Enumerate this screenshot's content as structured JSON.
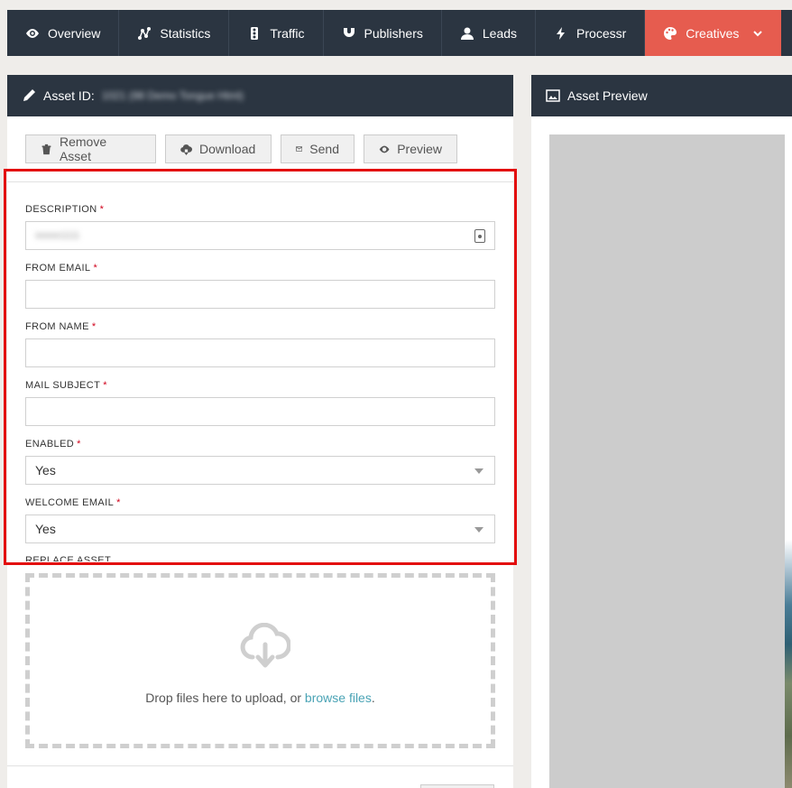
{
  "nav": {
    "items": [
      {
        "label": "Overview",
        "icon": "eye-icon"
      },
      {
        "label": "Statistics",
        "icon": "chart-line-icon"
      },
      {
        "label": "Traffic",
        "icon": "traffic-light-icon"
      },
      {
        "label": "Publishers",
        "icon": "magnet-icon"
      },
      {
        "label": "Leads",
        "icon": "user-icon"
      },
      {
        "label": "Processr",
        "icon": "lightning-icon"
      },
      {
        "label": "Creatives",
        "icon": "palette-icon",
        "active": true
      }
    ]
  },
  "left_panel": {
    "header_label": "Asset ID:",
    "header_value": "1021 (98 Demo Tongue Html)"
  },
  "toolbar": {
    "remove": "Remove Asset",
    "download": "Download",
    "send": "Send",
    "preview": "Preview"
  },
  "form": {
    "description": {
      "label": "DESCRIPTION",
      "value": "sssss1111"
    },
    "from_email": {
      "label": "FROM EMAIL",
      "value": ""
    },
    "from_name": {
      "label": "FROM NAME",
      "value": ""
    },
    "mail_subject": {
      "label": "MAIL SUBJECT",
      "value": ""
    },
    "enabled": {
      "label": "ENABLED",
      "value": "Yes"
    },
    "welcome_email": {
      "label": "WELCOME EMAIL",
      "value": "Yes"
    },
    "replace_asset": {
      "label": "REPLACE ASSET"
    },
    "required_mark": "*"
  },
  "dropzone": {
    "text": "Drop files here to upload, or ",
    "link": "browse files",
    "suffix": "."
  },
  "right_panel": {
    "header_label": "Asset Preview"
  },
  "colors": {
    "nav_bg": "#2b3541",
    "active_tab": "#e65c4f",
    "highlight": "#e30d0d",
    "link": "#4aa3b5"
  }
}
